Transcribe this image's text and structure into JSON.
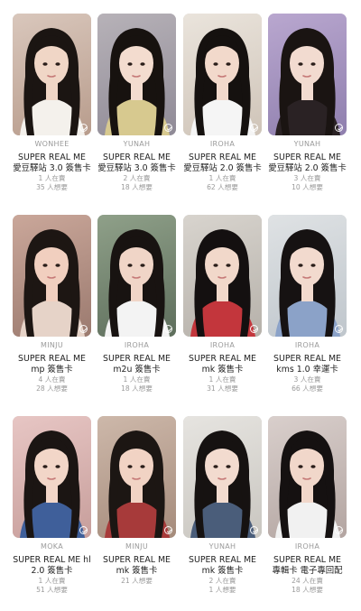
{
  "cards": [
    {
      "member": "WONHEE",
      "title": "SUPER REAL ME 愛豆驛站 3.0 簽售卡",
      "stat1": "1 人在賣",
      "stat2": "35 人想要",
      "bg1": "#d9c7bc",
      "bg2": "#b89c8c",
      "hair": "#1b1512",
      "skin": "#f0d6c6",
      "top": "#f4f1ec"
    },
    {
      "member": "YUNAH",
      "title": "SUPER REAL ME 愛豆驛站 3.0 簽售卡",
      "stat1": "2 人在賣",
      "stat2": "18 人想要",
      "bg1": "#b7b2b8",
      "bg2": "#8f8a96",
      "hair": "#17120f",
      "skin": "#f3dccf",
      "top": "#d7c98f"
    },
    {
      "member": "IROHA",
      "title": "SUPER REAL ME 愛豆驛站 2.0 簽售卡",
      "stat1": "1 人在賣",
      "stat2": "62 人想要",
      "bg1": "#eae4dc",
      "bg2": "#cfc4b8",
      "hair": "#15110f",
      "skin": "#f2d9cb",
      "top": "#f5f5f5"
    },
    {
      "member": "YUNAH",
      "title": "SUPER REAL ME 愛豆驛站 2.0 簽售卡",
      "stat1": "3 人在賣",
      "stat2": "10 人想要",
      "bg1": "#b9a7cf",
      "bg2": "#8f7fae",
      "hair": "#1a1412",
      "skin": "#f2dbd0",
      "top": "#2a2224"
    },
    {
      "member": "MINJU",
      "title": "SUPER REAL ME mp 簽售卡",
      "stat1": "4 人在賣",
      "stat2": "28 人想要",
      "bg1": "#caa79a",
      "bg2": "#9b7a6f",
      "hair": "#1d1613",
      "skin": "#f1cfbf",
      "top": "#e6d3c8"
    },
    {
      "member": "IROHA",
      "title": "SUPER REAL ME m2u 簽售卡",
      "stat1": "1 人在賣",
      "stat2": "18 人想要",
      "bg1": "#8fa089",
      "bg2": "#5e6e5c",
      "hair": "#181311",
      "skin": "#f0d5c7",
      "top": "#f3f3f3"
    },
    {
      "member": "IROHA",
      "title": "SUPER REAL ME mk 簽售卡",
      "stat1": "1 人在賣",
      "stat2": "31 人想要",
      "bg1": "#d8d4ce",
      "bg2": "#b6b1aa",
      "hair": "#141010",
      "skin": "#f1d8ca",
      "top": "#c3363c"
    },
    {
      "member": "IROHA",
      "title": "SUPER REAL ME kms 1.0 幸運卡",
      "stat1": "3 人在賣",
      "stat2": "66 人想要",
      "bg1": "#dfe2e4",
      "bg2": "#bfc6cc",
      "hair": "#161212",
      "skin": "#f2dace",
      "top": "#8ba2c8"
    },
    {
      "member": "MOKA",
      "title": "SUPER REAL ME hl 2.0 簽售卡",
      "stat1": "1 人在賣",
      "stat2": "51 人想要",
      "bg1": "#e7c6c4",
      "bg2": "#c79e9b",
      "hair": "#1b1513",
      "skin": "#f2d6c8",
      "top": "#3f5f9a"
    },
    {
      "member": "MINJU",
      "title": "SUPER REAL ME mk 簽售卡",
      "stat1": "21 人想要",
      "stat2": "",
      "bg1": "#cdb8aa",
      "bg2": "#a58b7b",
      "hair": "#1c1613",
      "skin": "#f1d3c4",
      "top": "#a73a3a"
    },
    {
      "member": "YUNAH",
      "title": "SUPER REAL ME mk 簽售卡",
      "stat1": "2 人在賣",
      "stat2": "1 人想要",
      "bg1": "#e6e4e0",
      "bg2": "#c9c6c0",
      "hair": "#161211",
      "skin": "#f2dbcf",
      "top": "#4a5d7a"
    },
    {
      "member": "IROHA",
      "title": "SUPER REAL ME 專輯卡 電子專回配",
      "stat1": "24 人在賣",
      "stat2": "18 人想要",
      "bg1": "#d9cfcc",
      "bg2": "#b3a5a1",
      "hair": "#151111",
      "skin": "#f1d7ca",
      "top": "#f1f1f1"
    }
  ]
}
